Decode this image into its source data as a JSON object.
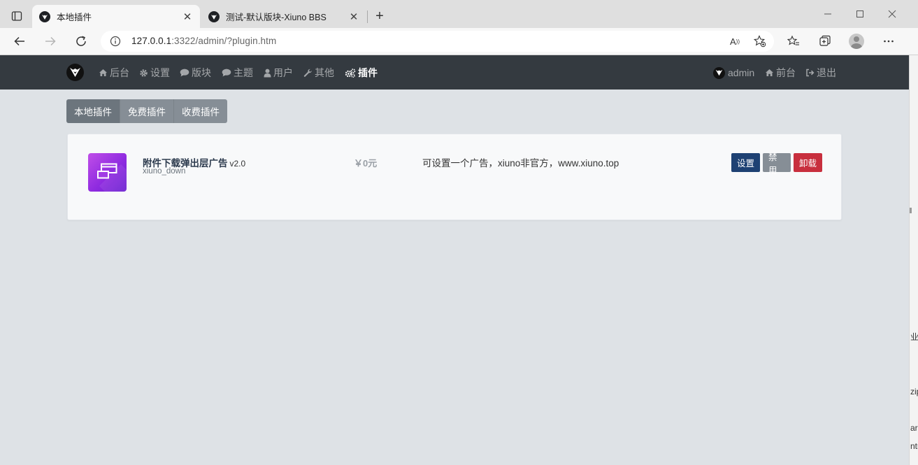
{
  "browser": {
    "tabs": [
      {
        "title": "本地插件",
        "active": true
      },
      {
        "title": "测试-默认版块-Xiuno BBS",
        "active": false
      }
    ],
    "url": {
      "host": "127.0.0.1",
      "rest": ":3322/admin/?plugin.htm"
    }
  },
  "navbar": {
    "left_items": [
      {
        "label": "后台",
        "icon": "home-icon"
      },
      {
        "label": "设置",
        "icon": "gear-icon"
      },
      {
        "label": "版块",
        "icon": "comment-icon"
      },
      {
        "label": "主题",
        "icon": "comment-icon"
      },
      {
        "label": "用户",
        "icon": "user-icon"
      },
      {
        "label": "其他",
        "icon": "wrench-icon"
      },
      {
        "label": "插件",
        "icon": "gears-icon"
      }
    ],
    "user": "admin",
    "front": "前台",
    "logout": "退出"
  },
  "plugin_tabs": [
    "本地插件",
    "免费插件",
    "收费插件"
  ],
  "plugin": {
    "name": "附件下载弹出层广告",
    "version": "v2.0",
    "dir": "xiuno_down",
    "price": "￥0元",
    "description": "可设置一个广告，xiuno非官方，www.xiuno.top",
    "actions": {
      "setting": "设置",
      "disable": "禁用",
      "uninstall": "卸载"
    }
  },
  "desktop_edge": {
    "fragments": [
      "业",
      "zip",
      "ar.c",
      "ntr"
    ]
  },
  "colors": {
    "navbar_bg": "#343a40",
    "page_bg": "#dee2e6",
    "setting_btn": "#1e4173",
    "disable_btn": "#868e96",
    "uninstall_btn": "#c82f3e"
  }
}
